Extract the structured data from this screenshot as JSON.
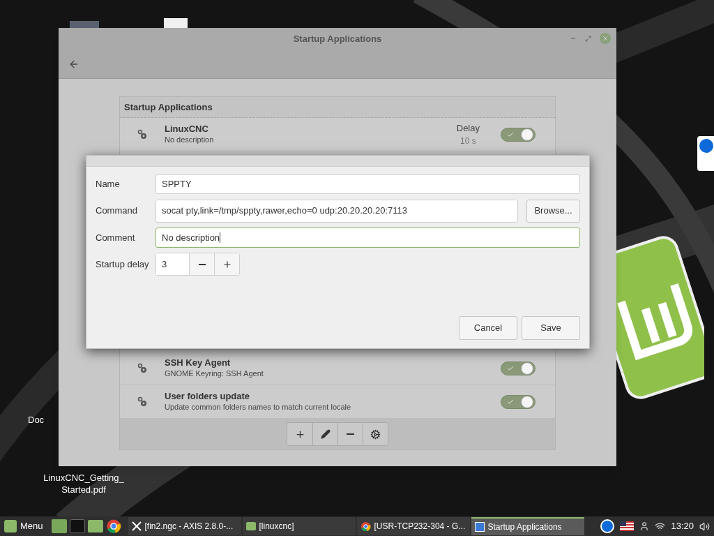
{
  "desktop": {
    "icons": [
      {
        "label_lines": [
          "Doc"
        ]
      },
      {
        "label_lines": [
          "LinuxCNC_Getting_",
          "Started.pdf"
        ]
      }
    ]
  },
  "window": {
    "title": "Startup Applications",
    "list_header": "Startup Applications",
    "apps_above": [
      {
        "name": "LinuxCNC",
        "description": "No description",
        "delay_label": "Delay",
        "delay_value": "10 s",
        "enabled": true
      }
    ],
    "apps_below": [
      {
        "name": "SSH Key Agent",
        "description": "GNOME Keyring: SSH Agent",
        "enabled": true
      },
      {
        "name": "User folders update",
        "description": "Update common folders names to match current locale",
        "enabled": true
      }
    ]
  },
  "dialog": {
    "name_label": "Name",
    "name_value": "SPPTY",
    "command_label": "Command",
    "command_value": "socat pty,link=/tmp/sppty,rawer,echo=0 udp:20.20.20.20:7113",
    "browse_button": "Browse...",
    "comment_label": "Comment",
    "comment_value": "No description",
    "comment_focused": true,
    "delay_label": "Startup delay",
    "delay_value": "3",
    "buttons": [
      {
        "label": "Cancel"
      },
      {
        "label": "Save"
      }
    ]
  },
  "taskbar": {
    "menu_label": "Menu",
    "window_buttons": [
      {
        "label": "[fin2.ngc - AXIS 2.8.0-...",
        "kind": "axis",
        "selected": false
      },
      {
        "label": "[linuxcnc]",
        "kind": "folder",
        "selected": false
      },
      {
        "label": "[USR-TCP232-304 - G...",
        "kind": "browser",
        "selected": false
      },
      {
        "label": "Startup Applications",
        "kind": "app",
        "selected": true
      }
    ],
    "clock": "13:20"
  }
}
